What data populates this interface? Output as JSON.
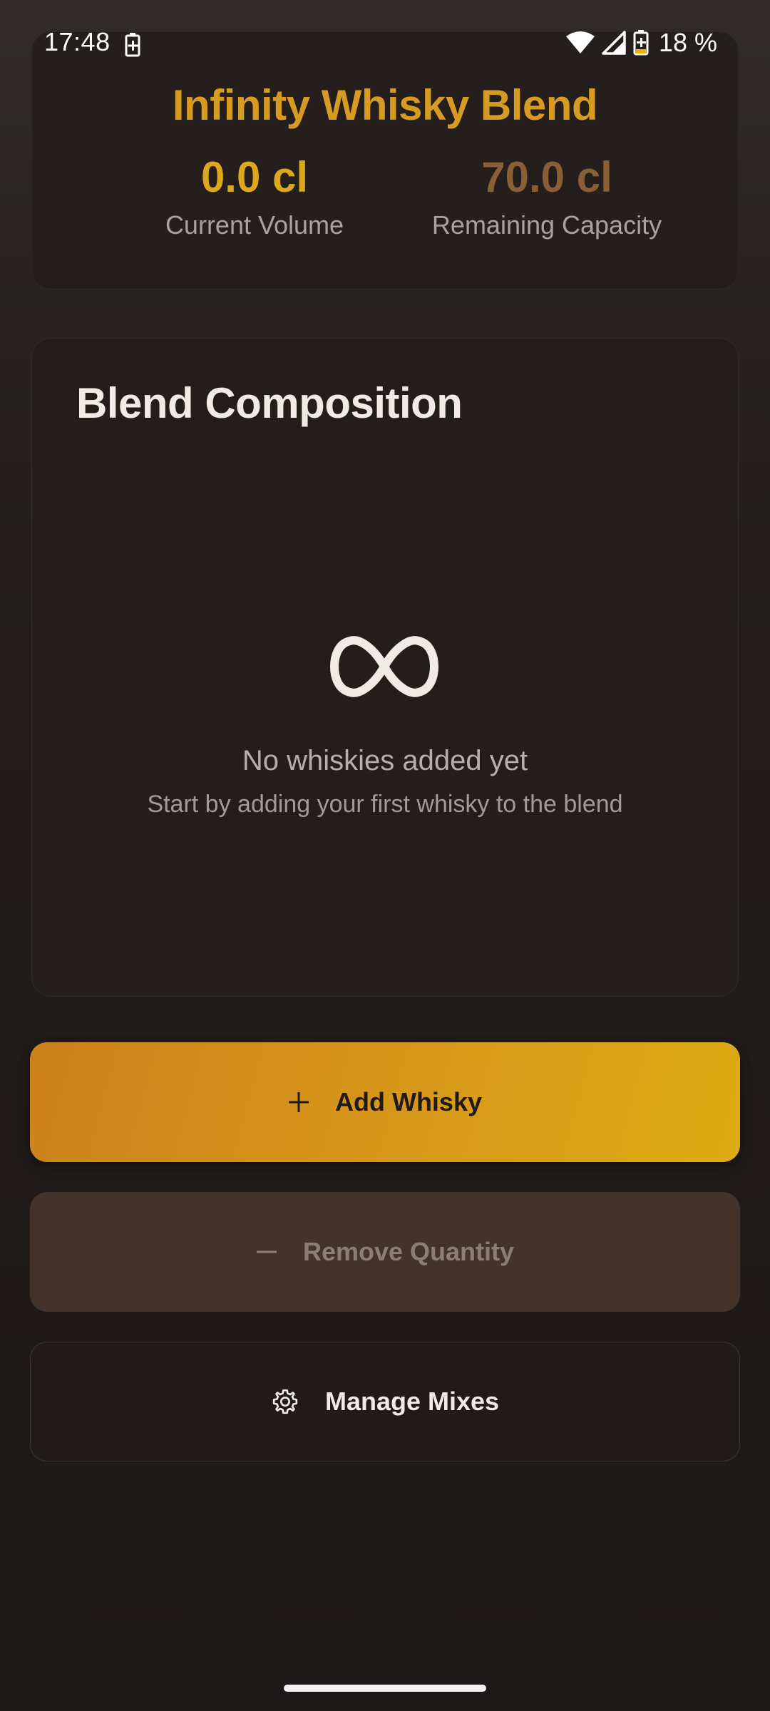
{
  "status_bar": {
    "time": "17:48",
    "battery_percent": "18 %",
    "icons": [
      "battery-saver-icon",
      "wifi-icon",
      "signal-icon",
      "battery-icon"
    ]
  },
  "header": {
    "title": "Infinity Whisky Blend",
    "current_volume": {
      "value": "0.0 cl",
      "label": "Current Volume"
    },
    "remaining_capacity": {
      "value": "70.0 cl",
      "label": "Remaining Capacity"
    }
  },
  "composition": {
    "title": "Blend Composition",
    "empty_icon": "infinity-icon",
    "empty_title": "No whiskies added yet",
    "empty_subtitle": "Start by adding your first whisky to the blend"
  },
  "actions": {
    "add": {
      "label": "Add Whisky",
      "icon": "plus-icon"
    },
    "remove": {
      "label": "Remove Quantity",
      "icon": "minus-icon"
    },
    "manage": {
      "label": "Manage Mixes",
      "icon": "gear-icon"
    }
  },
  "colors": {
    "accent_gold": "#d89b22",
    "current_value": "#dda81c",
    "remaining_value": "#8a5f36",
    "add_button_start": "#cc821c",
    "add_button_end": "#deac14"
  }
}
